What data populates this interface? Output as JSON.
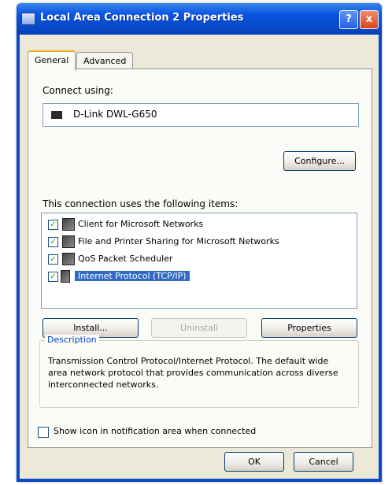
{
  "window": {
    "title": "Local Area Connection 2 Properties",
    "help_label": "?",
    "close_label": "x"
  },
  "tabs": [
    {
      "label": "General"
    },
    {
      "label": "Advanced"
    }
  ],
  "general": {
    "connect_using_label": "Connect using:",
    "device_name": "D-Link DWL-G650",
    "configure_label": "Configure...",
    "items_label": "This connection uses the following items:",
    "items": [
      {
        "label": "Client for Microsoft Networks",
        "checked": true
      },
      {
        "label": "File and Printer Sharing for Microsoft Networks",
        "checked": true
      },
      {
        "label": "QoS Packet Scheduler",
        "checked": true
      },
      {
        "label": "Internet Protocol (TCP/IP)",
        "checked": true,
        "selected": true
      }
    ],
    "install_label": "Install...",
    "uninstall_label": "Uninstall",
    "properties_label": "Properties",
    "description_title": "Description",
    "description_text": "Transmission Control Protocol/Internet Protocol. The default wide area network protocol that provides communication across diverse interconnected networks.",
    "show_icon_label": "Show icon in notification area when connected"
  },
  "footer": {
    "ok_label": "OK",
    "cancel_label": "Cancel"
  },
  "icons": {
    "window": "network-connection-icon",
    "device": "network-adapter-icon",
    "client": "network-client-icon",
    "service": "printer-sharing-icon",
    "scheduler": "packet-scheduler-icon",
    "protocol": "protocol-icon"
  },
  "colors": {
    "title_bar": "#0a54e3",
    "selection": "#316ac5",
    "dialog_bg": "#ece9d8"
  }
}
